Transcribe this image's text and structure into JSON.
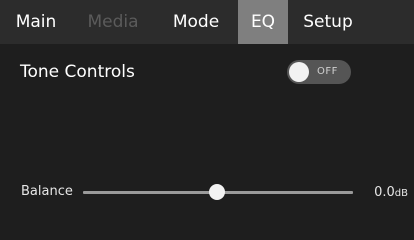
{
  "tabs": [
    {
      "label": "Main",
      "state": "normal"
    },
    {
      "label": "Media",
      "state": "disabled"
    },
    {
      "label": "Mode",
      "state": "normal"
    },
    {
      "label": "EQ",
      "state": "active"
    },
    {
      "label": "Setup",
      "state": "normal"
    }
  ],
  "tone_controls": {
    "title": "Tone Controls",
    "toggle_label": "OFF",
    "enabled": false
  },
  "balance": {
    "label": "Balance",
    "value": "0.0",
    "unit": "dB"
  },
  "colors": {
    "background": "#1e1e1e",
    "tabbar": "#2c2c2c",
    "active_tab": "#7f7f7f",
    "disabled_text": "#5b5b5b"
  }
}
